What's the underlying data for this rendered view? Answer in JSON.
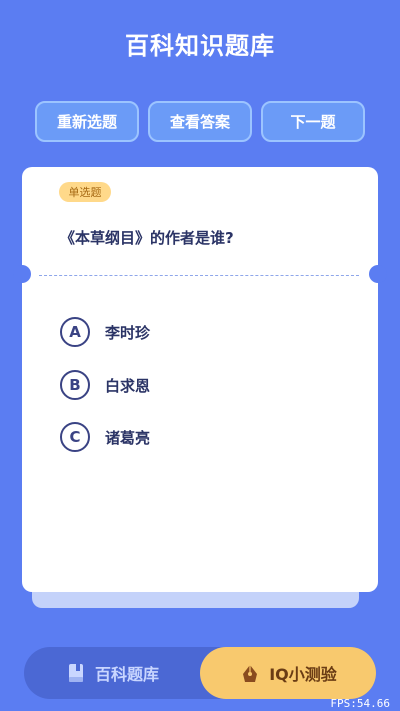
{
  "app": {
    "title": "百科知识题库"
  },
  "actions": {
    "restart_label": "重新选题",
    "answer_label": "查看答案",
    "next_label": "下一题"
  },
  "question": {
    "type_badge": "单选题",
    "text": "《本草纲目》的作者是谁?",
    "options": [
      {
        "letter": "A",
        "text": "李时珍"
      },
      {
        "letter": "B",
        "text": "白求恩"
      },
      {
        "letter": "C",
        "text": "诸葛亮"
      }
    ]
  },
  "tabs": {
    "bank": {
      "label": "百科题库",
      "icon": "book-icon"
    },
    "iq": {
      "label": "IQ小测验",
      "icon": "pen-icon",
      "active": true
    }
  },
  "debug": {
    "fps": "FPS:54.66"
  },
  "colors": {
    "background": "#5b7df2",
    "accent_yellow": "#f8c96e",
    "text_dark": "#2b3466"
  }
}
